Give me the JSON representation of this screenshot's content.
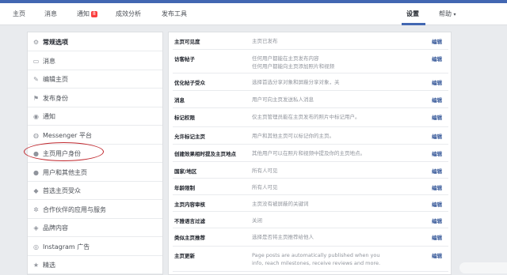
{
  "nav": {
    "items": [
      "主页",
      "消息",
      "通知",
      "成效分析",
      "发布工具"
    ],
    "notif_badge": "8",
    "settings": "设置",
    "help": "帮助",
    "help_caret": "▾"
  },
  "sidebar": {
    "items": [
      {
        "label": "常规选项",
        "icon": "gear-icon",
        "glyph": "⚙"
      },
      {
        "label": "消息",
        "icon": "message-icon",
        "glyph": "▭"
      },
      {
        "label": "编辑主页",
        "icon": "pencil-icon",
        "glyph": "✎"
      },
      {
        "label": "发布身份",
        "icon": "flag-icon",
        "glyph": "⚑"
      },
      {
        "label": "通知",
        "icon": "globe-icon",
        "glyph": "◉"
      },
      {
        "label": "Messenger 平台",
        "icon": "messenger-icon",
        "glyph": "◍"
      },
      {
        "label": "主页用户身份",
        "icon": "user-icon",
        "glyph": "●"
      },
      {
        "label": "用户和其他主页",
        "icon": "users-icon",
        "glyph": "●"
      },
      {
        "label": "首选主页受众",
        "icon": "audience-icon",
        "glyph": "◆"
      },
      {
        "label": "合作伙伴的应用与服务",
        "icon": "apps-icon",
        "glyph": "✲"
      },
      {
        "label": "品牌内容",
        "icon": "branded-content-icon",
        "glyph": "◈"
      },
      {
        "label": "Instagram 广告",
        "icon": "instagram-icon",
        "glyph": "◎"
      },
      {
        "label": "精选",
        "icon": "star-icon",
        "glyph": "★"
      }
    ]
  },
  "settings_rows": [
    {
      "label": "主页可见度",
      "value": "主页已发布",
      "edit": "编辑"
    },
    {
      "label": "访客帖子",
      "value": "任何用户都能在主页发布内容\n任何用户都能向主页添加照片和视频",
      "edit": "编辑"
    },
    {
      "label": "优化帖子受众",
      "value": "选择首选分享对象和屏蔽分享对象，关",
      "edit": "编辑"
    },
    {
      "label": "消息",
      "value": "用户可向主页发送私人消息",
      "edit": "编辑"
    },
    {
      "label": "标记权限",
      "value": "仅主页管理员能在主页发布的照片中标记用户。",
      "edit": "编辑"
    },
    {
      "label": "允许标记主页",
      "value": "用户和其他主页可以标记你的主页。",
      "edit": "编辑"
    },
    {
      "label": "创建效果相时提及主页地点",
      "value": "其他用户可以在照片和视频中提及你的主页地点。",
      "edit": "编辑"
    },
    {
      "label": "国家/地区",
      "value": "所有人可见",
      "edit": "编辑"
    },
    {
      "label": "年龄限制",
      "value": "所有人可见",
      "edit": "编辑"
    },
    {
      "label": "主页内容审核",
      "value": "主页没有被屏蔽的关键词",
      "edit": "编辑"
    },
    {
      "label": "不雅语言过滤",
      "value": "关闭",
      "edit": "编辑"
    },
    {
      "label": "类似主页推荐",
      "value": "选择是否将主页推荐给他人",
      "edit": "编辑"
    },
    {
      "label": "主页更新",
      "value": "Page posts are automatically published when you\ninfo, reach milestones, receive reviews and more.",
      "edit": "编辑"
    }
  ],
  "colors": {
    "brand": "#4267b2",
    "link": "#365899",
    "highlight_circle": "#c0282e"
  }
}
